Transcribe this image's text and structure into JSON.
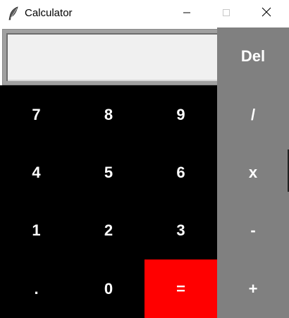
{
  "window": {
    "title": "Calculator",
    "icon": "feather-icon",
    "controls": [
      "minimize-icon",
      "maximize-icon",
      "close-icon"
    ]
  },
  "display": {
    "value": ""
  },
  "keys": {
    "del": "Del",
    "divide": "/",
    "multiply": "x",
    "minus": "-",
    "plus": "+",
    "equals": "=",
    "dot": ".",
    "n0": "0",
    "n1": "1",
    "n2": "2",
    "n3": "3",
    "n4": "4",
    "n5": "5",
    "n6": "6",
    "n7": "7",
    "n8": "8",
    "n9": "9"
  },
  "colors": {
    "number_bg": "#000000",
    "operator_bg": "#808080",
    "equals_bg": "#ff0000",
    "key_text": "#ffffff",
    "display_bg": "#f0f0f0"
  }
}
